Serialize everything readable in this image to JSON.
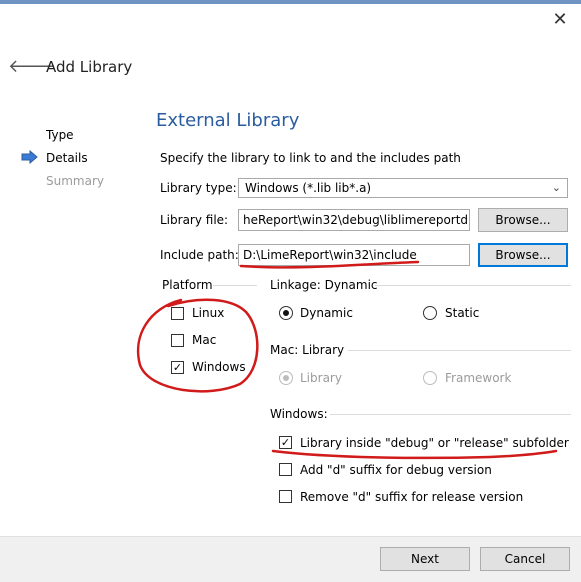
{
  "wizard": {
    "title": "Add Library",
    "steps": [
      {
        "label": "Type"
      },
      {
        "label": "Details"
      },
      {
        "label": "Summary"
      }
    ]
  },
  "page": {
    "heading": "External Library",
    "description": "Specify the library to link to and the includes path"
  },
  "form": {
    "library_type_label": "Library type:",
    "library_type_value": "Windows (*.lib lib*.a)",
    "library_file_label": "Library file:",
    "library_file_value": "heReport\\win32\\debug\\liblimereportd.a",
    "include_path_label": "Include path:",
    "include_path_value": "D:\\LimeReport\\win32\\include",
    "browse_label": "Browse..."
  },
  "platform": {
    "label": "Platform",
    "items": [
      {
        "label": "Linux",
        "checked": false
      },
      {
        "label": "Mac",
        "checked": false
      },
      {
        "label": "Windows",
        "checked": true
      }
    ]
  },
  "linkage": {
    "label": "Linkage: Dynamic",
    "options": [
      {
        "label": "Dynamic",
        "selected": true
      },
      {
        "label": "Static",
        "selected": false
      }
    ]
  },
  "mac": {
    "label": "Mac: Library",
    "options": [
      {
        "label": "Library",
        "selected": true,
        "disabled": true
      },
      {
        "label": "Framework",
        "selected": false,
        "disabled": true
      }
    ]
  },
  "windows": {
    "label": "Windows:",
    "options": [
      {
        "label": "Library inside \"debug\" or \"release\" subfolder",
        "checked": true
      },
      {
        "label": "Add \"d\" suffix for debug version",
        "checked": false
      },
      {
        "label": "Remove \"d\" suffix for release version",
        "checked": false
      }
    ]
  },
  "footer": {
    "next_label": "Next",
    "cancel_label": "Cancel"
  },
  "icons": {
    "close": "close-icon",
    "back": "back-arrow-icon",
    "current_step": "current-step-arrow-icon",
    "dropdown": "chevron-down-icon"
  },
  "colors": {
    "heading": "#2a5d9f",
    "annotation": "#d11a1a",
    "focus_border": "#0078d7",
    "step_arrow": "#3a7bd5"
  }
}
